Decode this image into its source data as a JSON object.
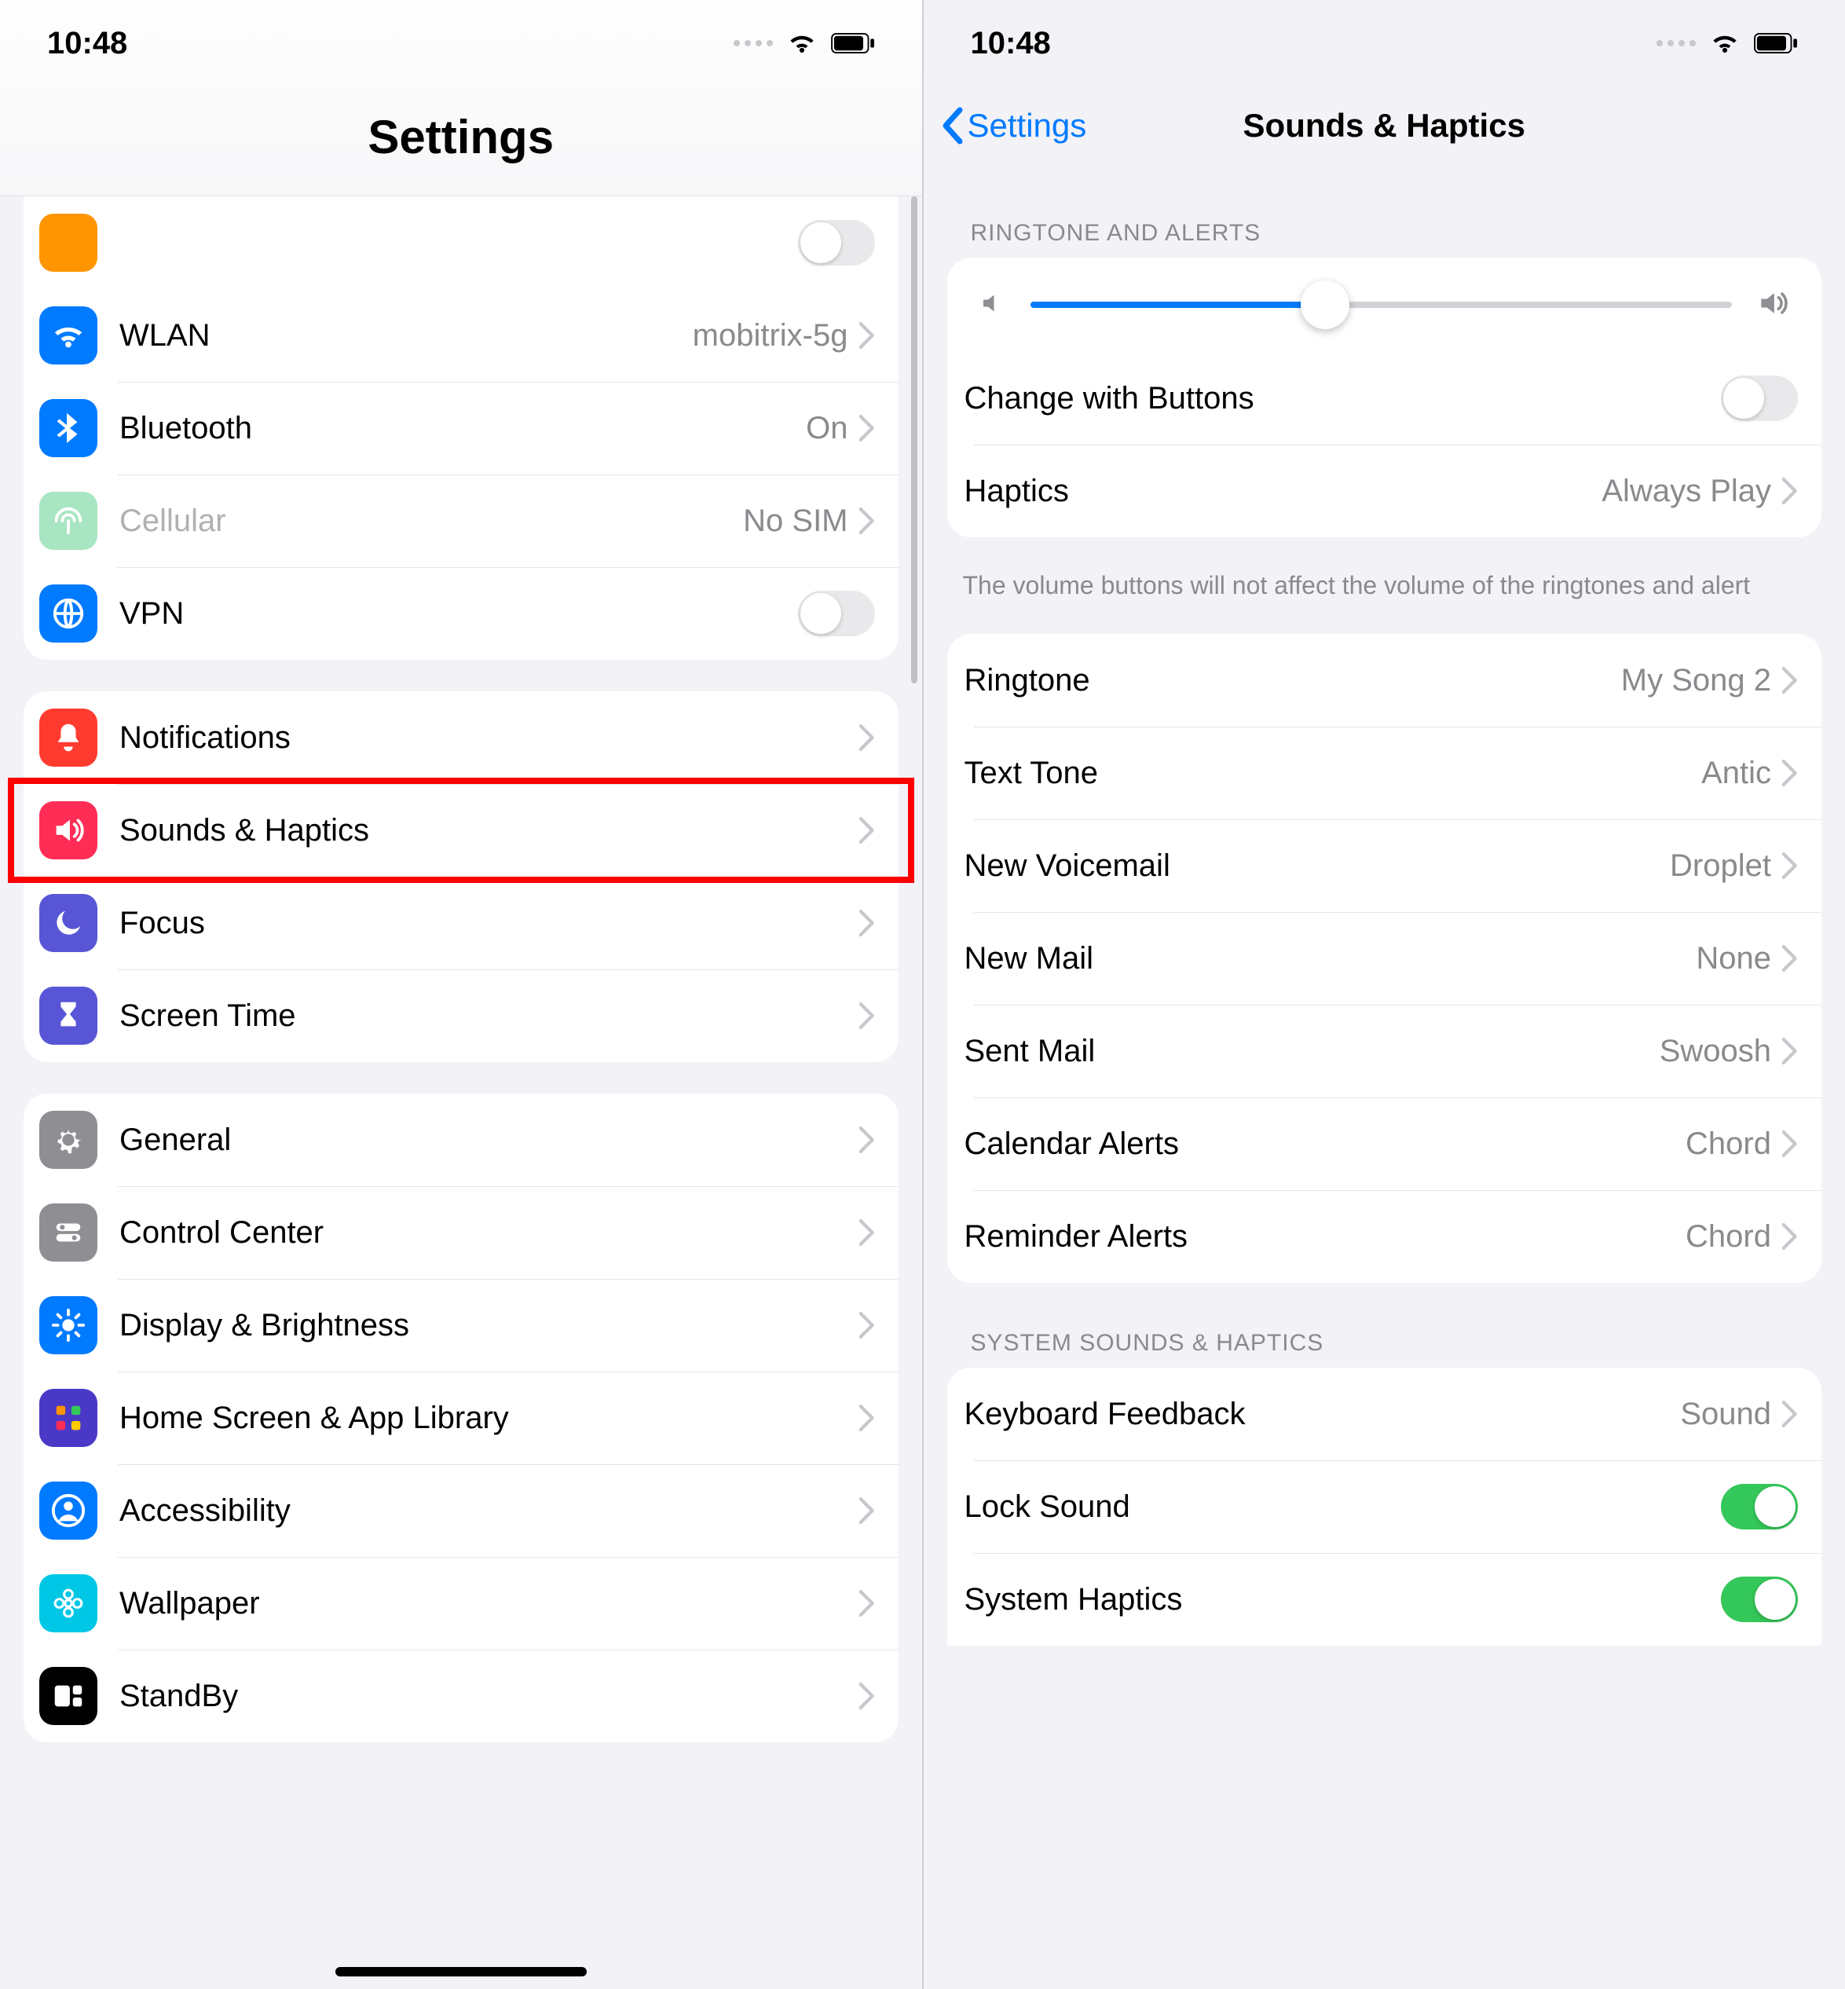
{
  "status": {
    "time": "10:48"
  },
  "left": {
    "title": "Settings",
    "sections": [
      {
        "rows": [
          {
            "id": "wlan",
            "icon": "wifi-icon",
            "color": "#007aff",
            "label": "WLAN",
            "value": "mobitrix-5g",
            "chevron": true
          },
          {
            "id": "bluetooth",
            "icon": "bluetooth-icon",
            "color": "#007aff",
            "label": "Bluetooth",
            "value": "On",
            "chevron": true
          },
          {
            "id": "cellular",
            "icon": "antenna-icon",
            "color": "#a8e5c2",
            "label": "Cellular",
            "value": "No SIM",
            "chevron": true,
            "dim": true
          },
          {
            "id": "vpn",
            "icon": "globe-icon",
            "color": "#007aff",
            "label": "VPN",
            "toggle": "off"
          }
        ]
      },
      {
        "rows": [
          {
            "id": "notifications",
            "icon": "bell-icon",
            "color": "#ff3b30",
            "label": "Notifications",
            "chevron": true
          },
          {
            "id": "sounds",
            "icon": "speaker-icon",
            "color": "#ff2d55",
            "label": "Sounds & Haptics",
            "chevron": true,
            "highlight": true
          },
          {
            "id": "focus",
            "icon": "moon-icon",
            "color": "#5856d6",
            "label": "Focus",
            "chevron": true
          },
          {
            "id": "screentime",
            "icon": "hourglass-icon",
            "color": "#5856d6",
            "label": "Screen Time",
            "chevron": true
          }
        ]
      },
      {
        "rows": [
          {
            "id": "general",
            "icon": "gear-icon",
            "color": "#8e8e93",
            "label": "General",
            "chevron": true
          },
          {
            "id": "controlcenter",
            "icon": "switches-icon",
            "color": "#8e8e93",
            "label": "Control Center",
            "chevron": true
          },
          {
            "id": "display",
            "icon": "sun-icon",
            "color": "#007aff",
            "label": "Display & Brightness",
            "chevron": true
          },
          {
            "id": "homescreen",
            "icon": "grid-icon",
            "color": "#4a39c7",
            "label": "Home Screen & App Library",
            "chevron": true
          },
          {
            "id": "accessibility",
            "icon": "person-circle-icon",
            "color": "#007aff",
            "label": "Accessibility",
            "chevron": true
          },
          {
            "id": "wallpaper",
            "icon": "flower-icon",
            "color": "#00c7e6",
            "label": "Wallpaper",
            "chevron": true
          },
          {
            "id": "standby",
            "icon": "clock-widget-icon",
            "color": "#000000",
            "label": "StandBy",
            "chevron": true
          }
        ]
      }
    ]
  },
  "right": {
    "back": "Settings",
    "title": "Sounds & Haptics",
    "ringtone_header": "RINGTONE AND ALERTS",
    "slider": {
      "value": 0.42
    },
    "change_buttons": {
      "label": "Change with Buttons",
      "toggle": "off"
    },
    "haptics": {
      "label": "Haptics",
      "value": "Always Play"
    },
    "footer1": "The volume buttons will not affect the volume of the ringtones and alert",
    "tones": [
      {
        "label": "Ringtone",
        "value": "My Song 2"
      },
      {
        "label": "Text Tone",
        "value": "Antic"
      },
      {
        "label": "New Voicemail",
        "value": "Droplet"
      },
      {
        "label": "New Mail",
        "value": "None"
      },
      {
        "label": "Sent Mail",
        "value": "Swoosh"
      },
      {
        "label": "Calendar Alerts",
        "value": "Chord"
      },
      {
        "label": "Reminder Alerts",
        "value": "Chord"
      }
    ],
    "system_header": "SYSTEM SOUNDS & HAPTICS",
    "system": [
      {
        "label": "Keyboard Feedback",
        "value": "Sound",
        "chevron": true
      },
      {
        "label": "Lock Sound",
        "toggle": "on"
      },
      {
        "label": "System Haptics",
        "toggle": "on"
      }
    ]
  }
}
